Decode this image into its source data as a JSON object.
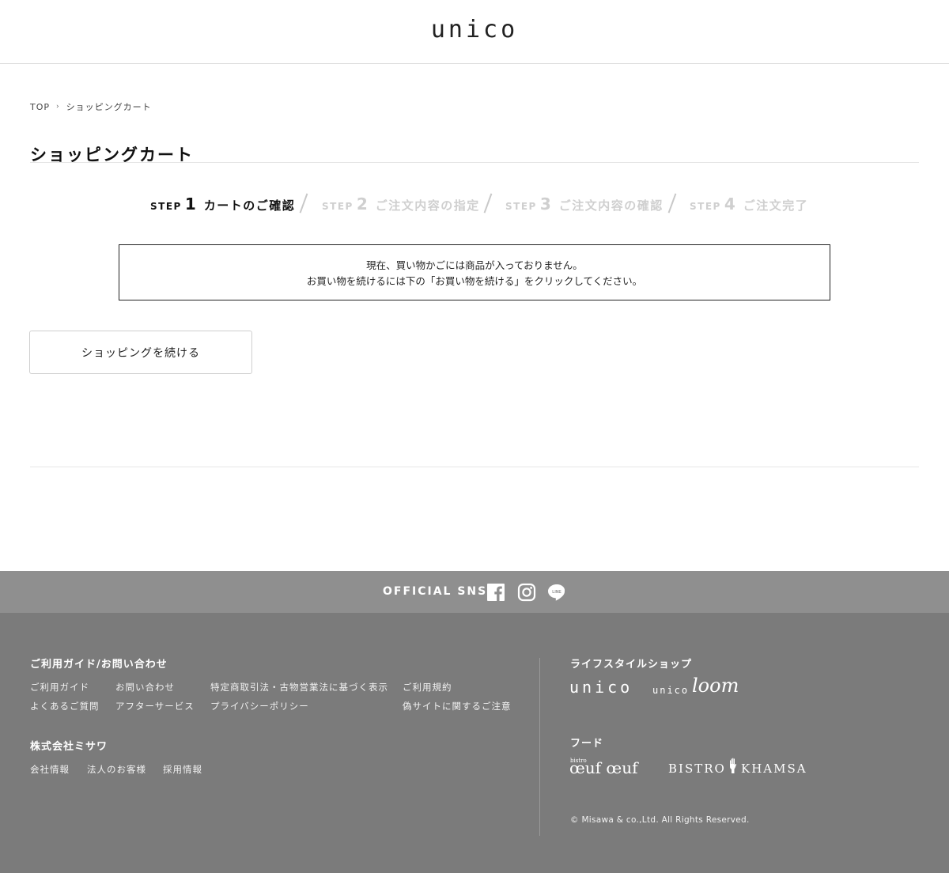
{
  "header": {
    "logo": "unico"
  },
  "breadcrumb": {
    "home": "TOP",
    "current": "ショッピングカート"
  },
  "page": {
    "title": "ショッピングカート"
  },
  "steps": [
    {
      "word": "STEP",
      "num": "1",
      "label": "カートのご確認",
      "active": true
    },
    {
      "word": "STEP",
      "num": "2",
      "label": "ご注文内容の指定",
      "active": false
    },
    {
      "word": "STEP",
      "num": "3",
      "label": "ご注文内容の確認",
      "active": false
    },
    {
      "word": "STEP",
      "num": "4",
      "label": "ご注文完了",
      "active": false
    }
  ],
  "message": {
    "line1": "現在、買い物かごには商品が入っておりません。",
    "line2": "お買い物を続けるには下の「お買い物を続ける」をクリックしてください。"
  },
  "continue_button": {
    "label": "ショッピングを続ける"
  },
  "sns": {
    "label": "OFFICIAL SNS",
    "icons": [
      "facebook-icon",
      "instagram-icon",
      "line-icon"
    ]
  },
  "footer": {
    "guide": {
      "heading": "ご利用ガイド/お問い合わせ",
      "links": {
        "guide": "ご利用ガイド",
        "contact": "お問い合わせ",
        "law": "特定商取引法・古物営業法に基づく表示",
        "terms": "ご利用規約",
        "faq": "よくあるご質問",
        "after_service": "アフターサービス",
        "privacy": "プライバシーポリシー",
        "fraud": "偽サイトに関するご注意"
      }
    },
    "company": {
      "heading": "株式会社ミサワ",
      "links": {
        "info": "会社情報",
        "corporate": "法人のお客様",
        "recruit": "採用情報"
      }
    },
    "lifestyle": {
      "heading": "ライフスタイルショップ",
      "brands": {
        "unico": "unico",
        "loom_small": "unico",
        "loom_script": "loom"
      }
    },
    "food": {
      "heading": "フード",
      "brands": {
        "oeuf_small": "bistro",
        "oeuf": "œuf œuf",
        "bistro": "BISTRO",
        "khamsa": "KHAMSA"
      }
    },
    "copyright": "© Misawa & co.,Ltd. All Rights Reserved."
  },
  "colors": {
    "footer_bg": "#7b7b7b",
    "sns_bar_bg": "#8f8f8f",
    "step_inactive": "#cfcfcf"
  }
}
